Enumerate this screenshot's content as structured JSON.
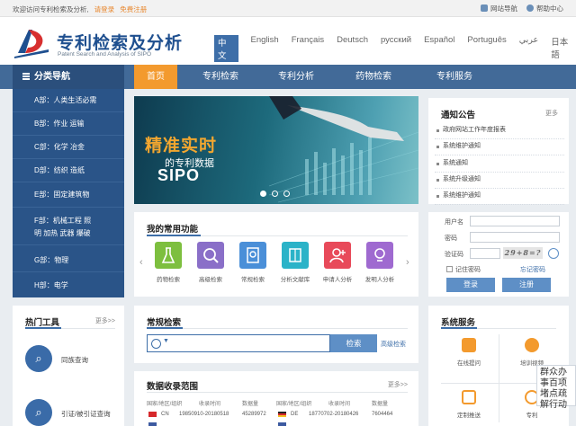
{
  "topbar": {
    "welcome": "欢迎访问专利检索及分析",
    "login": "请登录",
    "register": "免费注册",
    "site_nav": "网站导航",
    "help": "帮助中心"
  },
  "brand": {
    "name_cn": "专利检索及分析",
    "name_en": "Patent Search and Analysis of SIPO"
  },
  "languages": [
    "中文",
    "English",
    "Français",
    "Deutsch",
    "русский",
    "Español",
    "Português",
    "عربي",
    "日本語"
  ],
  "nav": {
    "category": "分类导航",
    "items": [
      "首页",
      "专利检索",
      "专利分析",
      "药物检索",
      "专利服务"
    ]
  },
  "categories": [
    "A部：人类生活必需",
    "B部：作业 运输",
    "C部：化学 冶金",
    "D部：纺织 造纸",
    "E部：固定建筑物",
    "F部：机械工程 照",
    "明 加热 武器 爆破",
    "G部：物理",
    "H部：电学"
  ],
  "banner": {
    "line1": "精准实时",
    "line2": "的专利数据",
    "line3": "SIPO"
  },
  "notice": {
    "title": "通知公告",
    "more": "更多",
    "items": [
      "政府网站工作年度报表",
      "系统维护通知",
      "系统通知",
      "系统升级通知",
      "系统维护通知"
    ]
  },
  "functions": {
    "title": "我的常用功能",
    "items": [
      {
        "label": "药物检索",
        "color": "#7dbf3f"
      },
      {
        "label": "高级检索",
        "color": "#8a6fc8"
      },
      {
        "label": "常规检索",
        "color": "#4a8fd8"
      },
      {
        "label": "分析文献库",
        "color": "#2bb3c8"
      },
      {
        "label": "申请人分析",
        "color": "#e84a5a"
      },
      {
        "label": "发明人分析",
        "color": "#9f6ad0"
      }
    ]
  },
  "login": {
    "username_label": "用户名",
    "password_label": "密码",
    "captcha_label": "验证码",
    "captcha_value": "29+8=?",
    "remember": "记住密码",
    "forgot": "忘记密码",
    "login_btn": "登录",
    "register_btn": "注册"
  },
  "tools": {
    "title": "热门工具",
    "more": "更多>>",
    "items": [
      "同族查询",
      "引证/被引证查询"
    ]
  },
  "search": {
    "title": "常规检索",
    "button": "检索",
    "advanced": "高级检索"
  },
  "stats": {
    "title": "数据收录范围",
    "more": "更多>>",
    "headers": [
      "国家/地区/组织",
      "收录时间",
      "数据量",
      "国家/地区/组织",
      "收录时间",
      "数据量"
    ],
    "rows": [
      [
        "CN",
        "19850910-20180518",
        "45289972",
        "DE",
        "18770702-20180426",
        "7604464"
      ]
    ]
  },
  "services": {
    "title": "系统服务",
    "items": [
      "在线提问",
      "培训视频",
      "定制推送",
      "专利"
    ]
  },
  "floating": "群众办事百项堵点疏解行动"
}
